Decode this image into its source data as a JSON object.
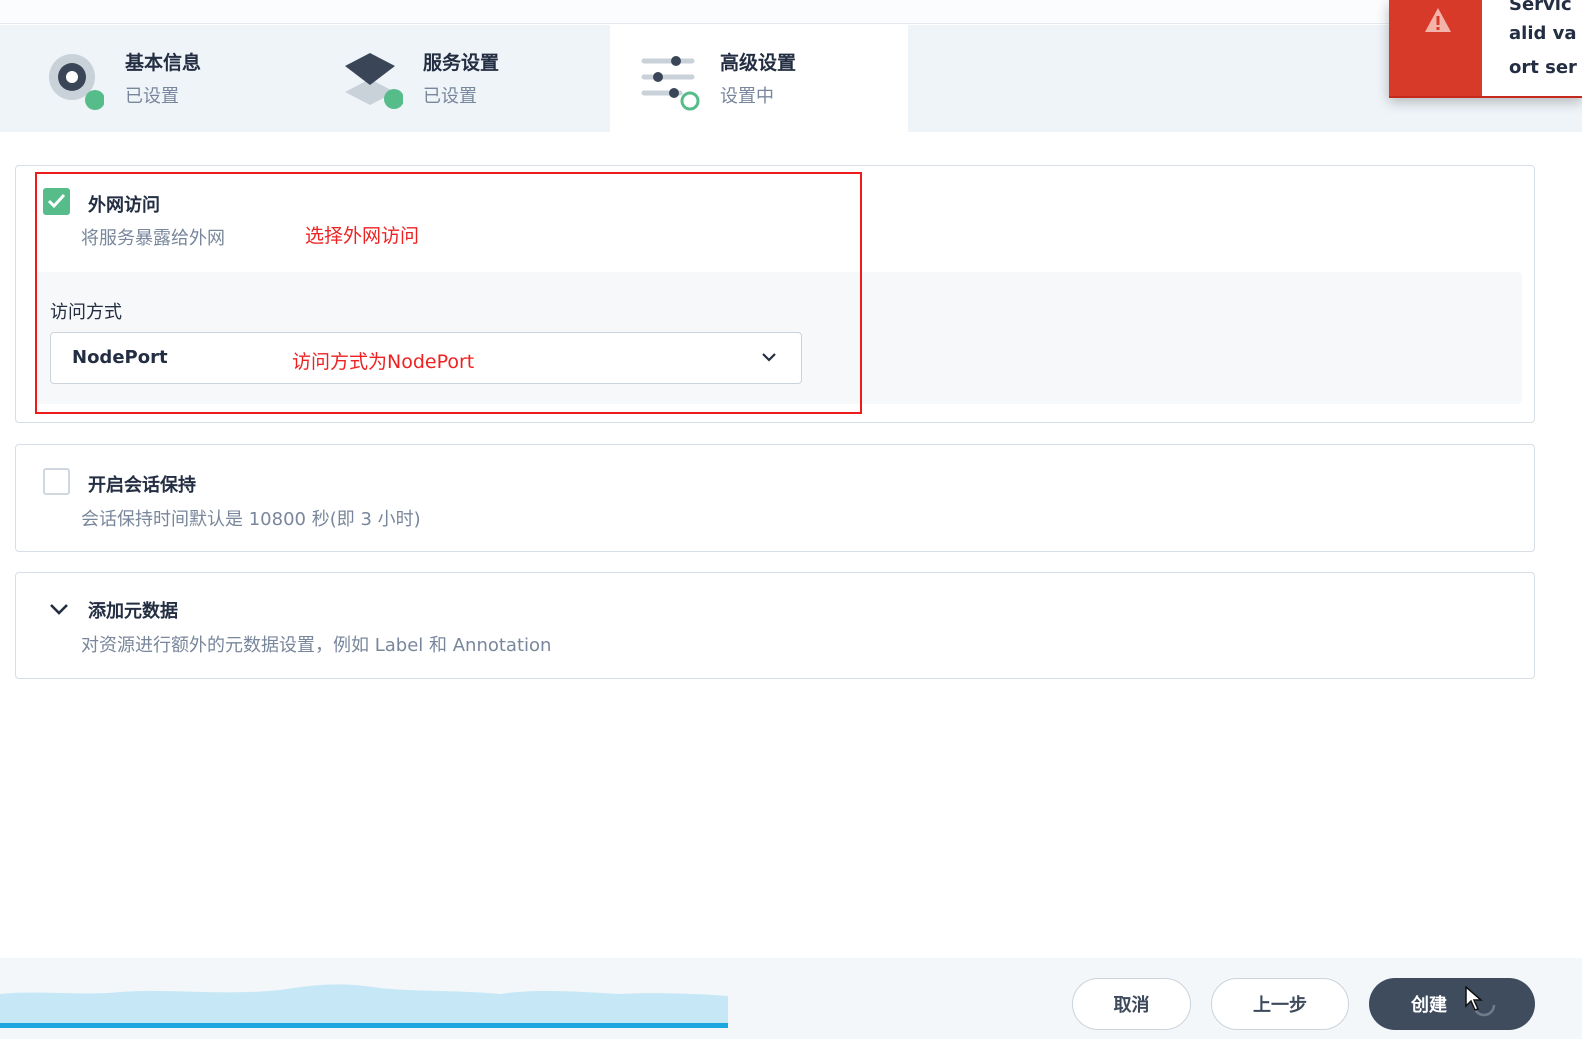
{
  "steps": [
    {
      "title": "基本信息",
      "status": "已设置",
      "icon": "gear-icon",
      "completed": true
    },
    {
      "title": "服务设置",
      "status": "已设置",
      "icon": "layers-icon",
      "completed": true
    },
    {
      "title": "高级设置",
      "status": "设置中",
      "icon": "sliders-icon",
      "completed": false
    }
  ],
  "toast": {
    "icon": "warning-icon",
    "lines": [
      "Servic",
      "alid va",
      "ort ser"
    ]
  },
  "external_access": {
    "checked": true,
    "title": "外网访问",
    "description": "将服务暴露给外网",
    "access_mode_label": "访问方式",
    "access_mode_value": "NodePort",
    "annotation_select": "选择外网访问",
    "annotation_mode": "访问方式为NodePort"
  },
  "session_affinity": {
    "checked": false,
    "title": "开启会话保持",
    "description": "会话保持时间默认是 10800 秒(即 3 小时)"
  },
  "metadata": {
    "title": "添加元数据",
    "description": "对资源进行额外的元数据设置，例如 Label 和 Annotation"
  },
  "footer": {
    "cancel": "取消",
    "previous": "上一步",
    "create": "创建"
  },
  "colors": {
    "accent_green": "#55bc8a",
    "error_red": "#d83a2a",
    "annotation_red": "#ee1b1b",
    "primary_button": "#3e4c5e"
  }
}
